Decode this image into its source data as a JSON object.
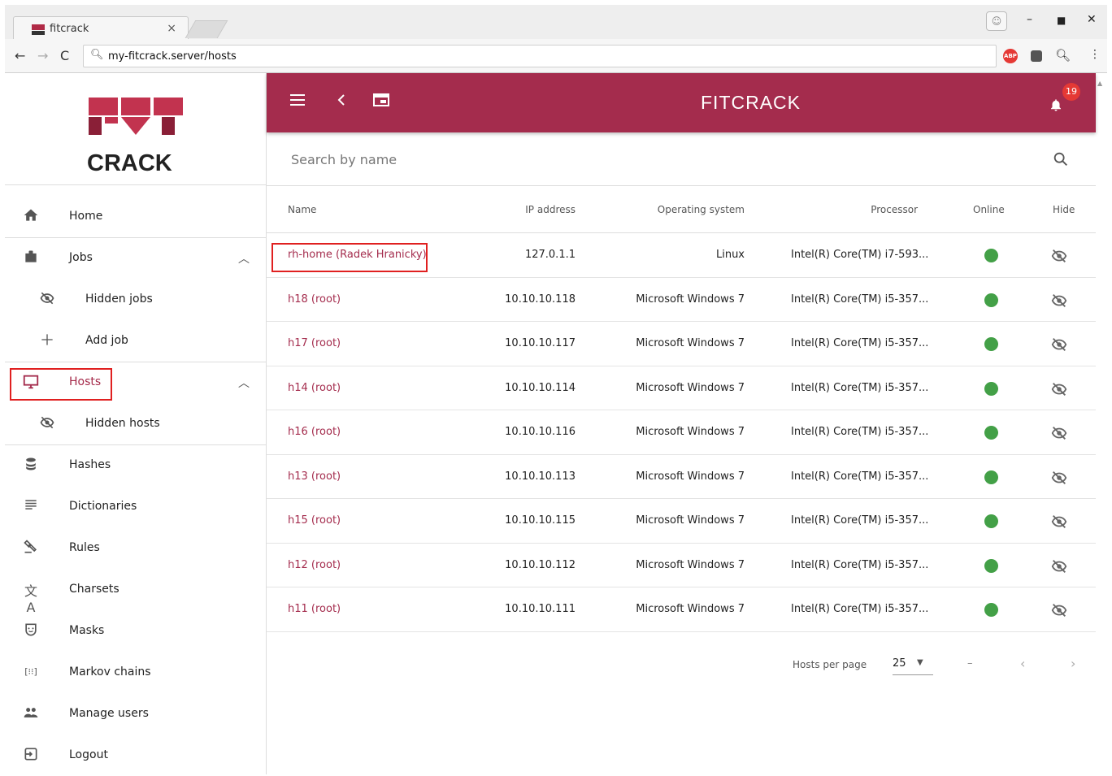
{
  "browser": {
    "tab_title": "fitcrack",
    "tab_close": "×",
    "url": "my-fitcrack.server/hosts",
    "ext_abp": "ABP"
  },
  "sidebar": {
    "logo_text": "CRACK",
    "items": [
      {
        "label": "Home",
        "icon": "home-icon"
      },
      {
        "label": "Jobs",
        "icon": "briefcase-icon"
      },
      {
        "label": "Hidden jobs",
        "icon": "eye-off-icon"
      },
      {
        "label": "Add job",
        "icon": "plus-icon"
      },
      {
        "label": "Hosts",
        "icon": "monitor-icon"
      },
      {
        "label": "Hidden hosts",
        "icon": "eye-off-icon"
      },
      {
        "label": "Hashes",
        "icon": "database-icon"
      },
      {
        "label": "Dictionaries",
        "icon": "list-icon"
      },
      {
        "label": "Rules",
        "icon": "gavel-icon"
      },
      {
        "label": "Charsets",
        "icon": "translate-icon"
      },
      {
        "label": "Masks",
        "icon": "mask-icon"
      },
      {
        "label": "Markov chains",
        "icon": "matrix-icon"
      },
      {
        "label": "Manage users",
        "icon": "users-icon"
      },
      {
        "label": "Logout",
        "icon": "logout-icon"
      }
    ],
    "accent": "#a42c4d"
  },
  "appbar": {
    "title": "FITCRACK",
    "notification_count": "19",
    "color": "#a42c4d"
  },
  "search": {
    "placeholder": "Search by name"
  },
  "table": {
    "columns": [
      "Name",
      "IP address",
      "Operating system",
      "Processor",
      "Online",
      "Hide"
    ],
    "rows": [
      {
        "name": "rh-home (Radek Hranicky)",
        "ip": "127.0.1.1",
        "os": "Linux",
        "cpu": "Intel(R) Core(TM) i7-593..."
      },
      {
        "name": "h18 (root)",
        "ip": "10.10.10.118",
        "os": "Microsoft Windows 7",
        "cpu": "Intel(R) Core(TM) i5-357..."
      },
      {
        "name": "h17 (root)",
        "ip": "10.10.10.117",
        "os": "Microsoft Windows 7",
        "cpu": "Intel(R) Core(TM) i5-357..."
      },
      {
        "name": "h14 (root)",
        "ip": "10.10.10.114",
        "os": "Microsoft Windows 7",
        "cpu": "Intel(R) Core(TM) i5-357..."
      },
      {
        "name": "h16 (root)",
        "ip": "10.10.10.116",
        "os": "Microsoft Windows 7",
        "cpu": "Intel(R) Core(TM) i5-357..."
      },
      {
        "name": "h13 (root)",
        "ip": "10.10.10.113",
        "os": "Microsoft Windows 7",
        "cpu": "Intel(R) Core(TM) i5-357..."
      },
      {
        "name": "h15 (root)",
        "ip": "10.10.10.115",
        "os": "Microsoft Windows 7",
        "cpu": "Intel(R) Core(TM) i5-357..."
      },
      {
        "name": "h12 (root)",
        "ip": "10.10.10.112",
        "os": "Microsoft Windows 7",
        "cpu": "Intel(R) Core(TM) i5-357..."
      },
      {
        "name": "h11 (root)",
        "ip": "10.10.10.111",
        "os": "Microsoft Windows 7",
        "cpu": "Intel(R) Core(TM) i5-357..."
      }
    ],
    "online_color": "#43a047"
  },
  "pagination": {
    "label": "Hosts per page",
    "per_page": "25",
    "range": "–",
    "prev": "‹",
    "next": "›"
  }
}
